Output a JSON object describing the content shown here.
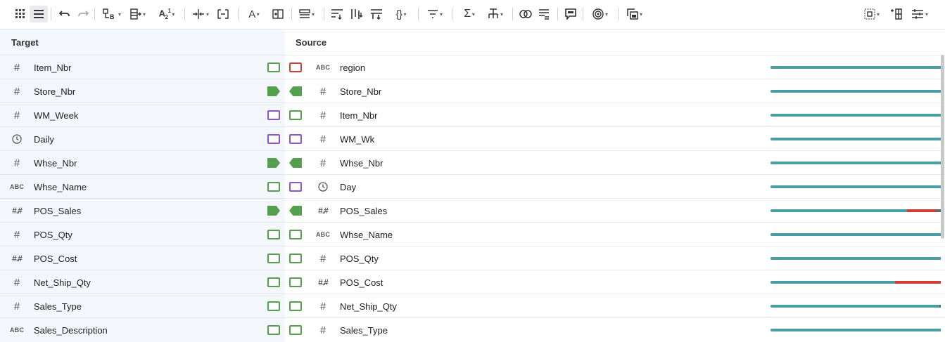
{
  "toolbar": {
    "icons": [
      "grid-view-icon",
      "list-view-icon",
      "undo-icon",
      "redo-icon",
      "schema-icon",
      "add-field-icon",
      "sort-alpha-icon",
      "split-column-icon",
      "expand-icon",
      "format-text-icon",
      "insert-column-icon",
      "menu-icon",
      "hierarchy-a-icon",
      "hierarchy-b-icon",
      "hierarchy-c-icon",
      "json-icon",
      "filter-icon",
      "sum-icon",
      "tree-icon",
      "join-icon",
      "pivot-icon",
      "comment-icon",
      "target-icon",
      "duplicate-icon",
      "frame-icon",
      "reorder-icon",
      "settings-sliders-icon"
    ]
  },
  "headers": {
    "target": "Target",
    "source": "Source"
  },
  "rows": [
    {
      "t_type": "#",
      "t_name": "Item_Nbr",
      "lport": "green",
      "rport": "red",
      "filled": false,
      "s_type": "ABC",
      "s_name": "region",
      "bar": [
        1.0,
        0.0
      ]
    },
    {
      "t_type": "#",
      "t_name": "Store_Nbr",
      "lport": "green",
      "rport": "green",
      "filled": true,
      "s_type": "#",
      "s_name": "Store_Nbr",
      "bar": [
        1.0,
        0.0
      ]
    },
    {
      "t_type": "#",
      "t_name": "WM_Week",
      "lport": "purple",
      "rport": "green",
      "filled": false,
      "s_type": "#",
      "s_name": "Item_Nbr",
      "bar": [
        1.0,
        0.0
      ]
    },
    {
      "t_type": "clock",
      "t_name": "Daily",
      "lport": "purple",
      "rport": "purple",
      "filled": false,
      "s_type": "#",
      "s_name": "WM_Wk",
      "bar": [
        1.0,
        0.0
      ]
    },
    {
      "t_type": "#",
      "t_name": "Whse_Nbr",
      "lport": "green",
      "rport": "green",
      "filled": true,
      "s_type": "#",
      "s_name": "Whse_Nbr",
      "bar": [
        1.0,
        0.0
      ]
    },
    {
      "t_type": "ABC",
      "t_name": "Whse_Name",
      "lport": "green",
      "rport": "purple",
      "filled": false,
      "s_type": "clock",
      "s_name": "Day",
      "bar": [
        1.0,
        0.0
      ]
    },
    {
      "t_type": "##",
      "t_name": "POS_Sales",
      "lport": "green",
      "rport": "green",
      "filled": true,
      "s_type": "##",
      "s_name": "POS_Sales",
      "bar": [
        0.8,
        0.17
      ]
    },
    {
      "t_type": "#",
      "t_name": "POS_Qty",
      "lport": "green",
      "rport": "green",
      "filled": false,
      "s_type": "ABC",
      "s_name": "Whse_Name",
      "bar": [
        1.0,
        0.0
      ]
    },
    {
      "t_type": "##",
      "t_name": "POS_Cost",
      "lport": "green",
      "rport": "green",
      "filled": false,
      "s_type": "#",
      "s_name": "POS_Qty",
      "bar": [
        1.0,
        0.0
      ]
    },
    {
      "t_type": "#",
      "t_name": "Net_Ship_Qty",
      "lport": "green",
      "rport": "green",
      "filled": false,
      "s_type": "##",
      "s_name": "POS_Cost",
      "bar": [
        0.73,
        0.27
      ]
    },
    {
      "t_type": "#",
      "t_name": "Sales_Type",
      "lport": "green",
      "rport": "green",
      "filled": false,
      "s_type": "#",
      "s_name": "Net_Ship_Qty",
      "bar": [
        0.99,
        0.0
      ]
    },
    {
      "t_type": "ABC",
      "t_name": "Sales_Description",
      "lport": "green",
      "rport": "green",
      "filled": false,
      "s_type": "#",
      "s_name": "Sales_Type",
      "bar": [
        1.0,
        0.0
      ]
    }
  ],
  "colors": {
    "green": "#55a04f",
    "red": "#d23c35",
    "purple": "#8c55d6",
    "teal": "#4a9ea3",
    "gray": "#666666"
  }
}
